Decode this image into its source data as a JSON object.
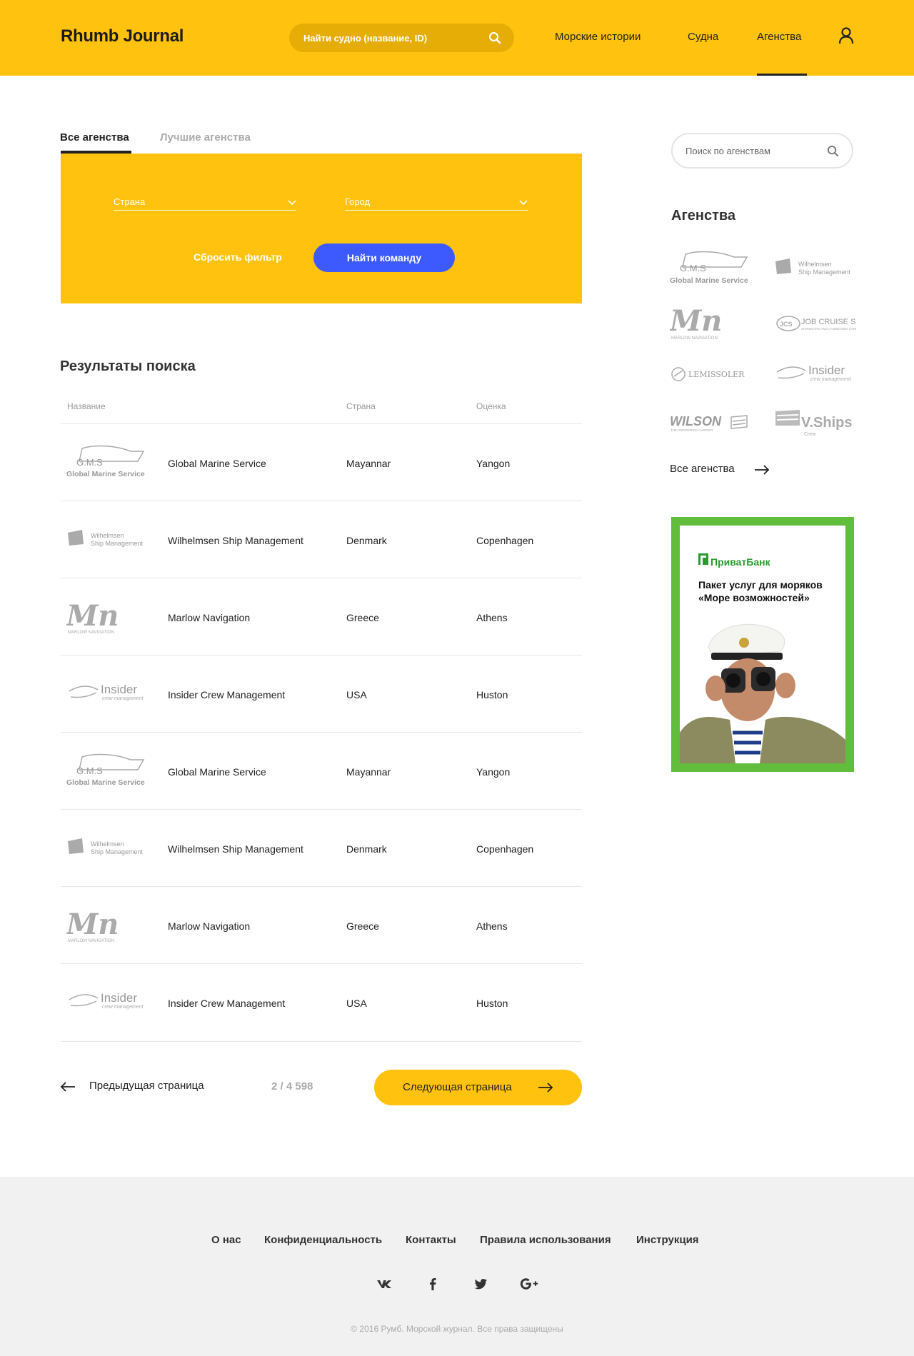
{
  "header": {
    "logo": "Rhumb Journal",
    "search_placeholder": "Найти судно (название, ID)",
    "nav": [
      "Морские истории",
      "Судна",
      "Агенства"
    ],
    "active_nav": "Агенства"
  },
  "tabs": {
    "all": "Все агенства",
    "best": "Лучшие агенства"
  },
  "filter": {
    "country_label": "Страна",
    "city_label": "Город",
    "reset_label": "Сбросить фильтр",
    "find_label": "Найти команду"
  },
  "results": {
    "title": "Результаты поиска",
    "columns": [
      "Название",
      "Страна",
      "Оценка"
    ],
    "rows": [
      {
        "logo": "gms-logo",
        "name": "Global Marine Service",
        "country": "Mayannar",
        "city": "Yangon"
      },
      {
        "logo": "wilhelmsen-logo",
        "name": "Wilhelmsen Ship Management",
        "country": "Denmark",
        "city": "Copenhagen"
      },
      {
        "logo": "marlow-logo",
        "name": "Marlow Navigation",
        "country": "Greece",
        "city": "Athens"
      },
      {
        "logo": "insider-logo",
        "name": "Insider Crew Management",
        "country": "USA",
        "city": "Huston"
      },
      {
        "logo": "gms-logo",
        "name": "Global Marine Service",
        "country": "Mayannar",
        "city": "Yangon"
      },
      {
        "logo": "wilhelmsen-logo",
        "name": "Wilhelmsen Ship Management",
        "country": "Denmark",
        "city": "Copenhagen"
      },
      {
        "logo": "marlow-logo",
        "name": "Marlow Navigation",
        "country": "Greece",
        "city": "Athens"
      },
      {
        "logo": "insider-logo",
        "name": "Insider Crew Management",
        "country": "USA",
        "city": "Huston"
      }
    ]
  },
  "pagination": {
    "prev_label": "Предыдущая страница",
    "page_indicator": "2 / 4 598",
    "next_label": "Следующая страница"
  },
  "sidebar": {
    "search_placeholder": "Поиск по агенствам",
    "title": "Агенства",
    "logos": [
      "G.M.S Global Marine Service",
      "Wilhelmsen Ship Management",
      "Marlow Navigation",
      "Job Cruise Ship",
      "Lemissoler",
      "Insider crew management",
      "Wilson",
      "V.Ships Crew"
    ],
    "all_label": "Все агенства",
    "ad": {
      "bank": "ПриватБанк",
      "text": "Пакет услуг для моряков «Море возможностей»"
    }
  },
  "footer": {
    "links": [
      "О нас",
      "Конфиденциальность",
      "Контакты",
      "Правила использования",
      "Инструкция"
    ],
    "social": [
      "vk-icon",
      "facebook-icon",
      "twitter-icon",
      "google-plus-icon"
    ],
    "copyright": "© 2016 Румб. Морской журнал. Все права защищены"
  },
  "colors": {
    "brand_yellow": "#ffc20e",
    "button_blue": "#3d5afe",
    "ad_green": "#61bd3b"
  }
}
